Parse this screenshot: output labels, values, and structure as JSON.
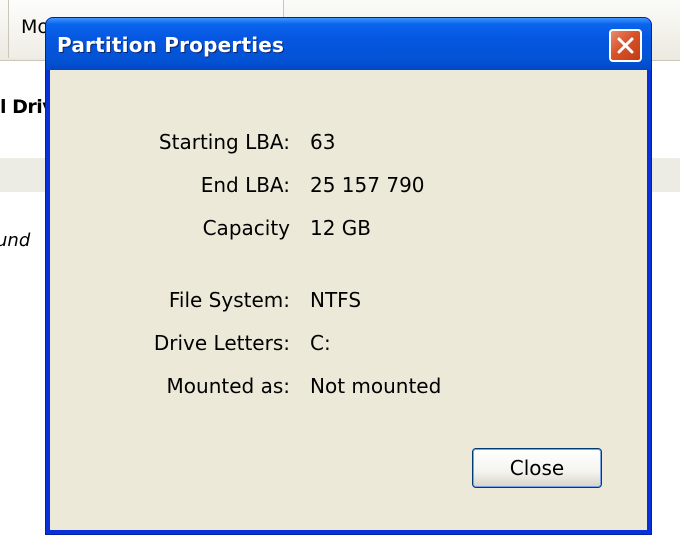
{
  "background": {
    "tab_label": "Mo",
    "heading": "l Driv",
    "italic_text": "und"
  },
  "dialog": {
    "title": "Partition Properties",
    "properties": [
      {
        "label": "Starting LBA:",
        "value": "63"
      },
      {
        "label": "End LBA:",
        "value": "25 157 790"
      },
      {
        "label": "Capacity",
        "value": "12 GB"
      },
      {
        "label": "File System:",
        "value": "NTFS"
      },
      {
        "label": "Drive Letters:",
        "value": "C:"
      },
      {
        "label": "Mounted as:",
        "value": "Not mounted"
      }
    ],
    "close_button_label": "Close"
  },
  "colors": {
    "titlebar_blue": "#0453d6",
    "client_bg": "#ece9d8",
    "close_red": "#d8532a"
  },
  "icons": {
    "close": "close-x-icon"
  }
}
